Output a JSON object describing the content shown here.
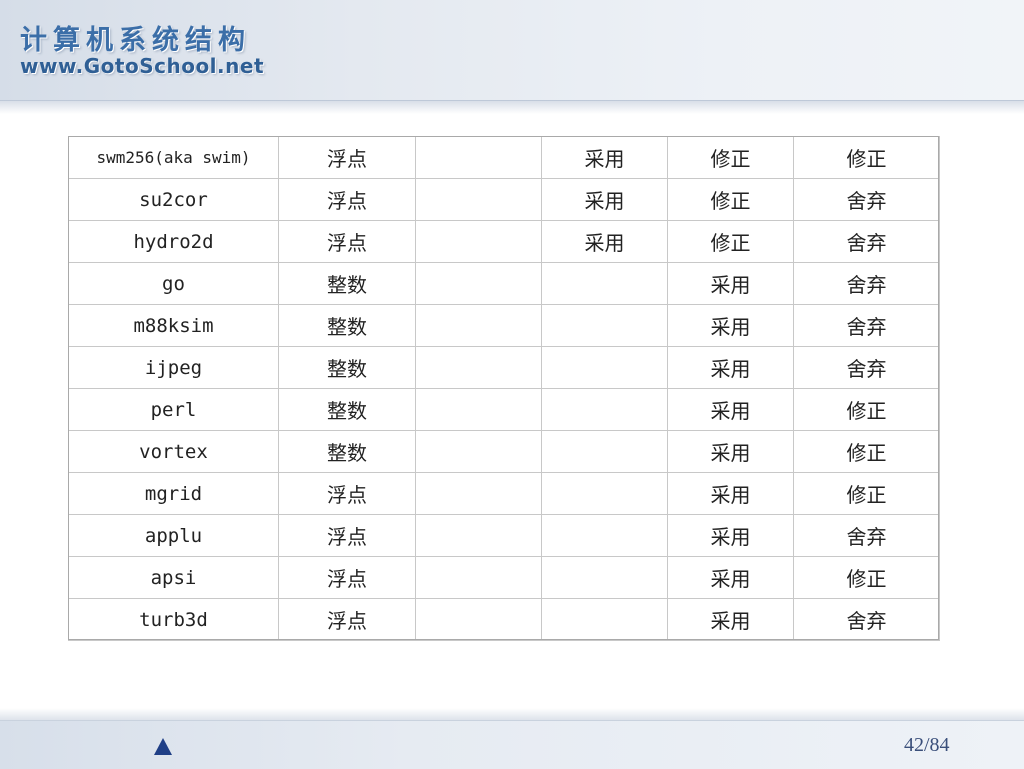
{
  "header": {
    "course_title": "计算机系统结构",
    "site_url": "www.GotoSchool.net"
  },
  "table": {
    "rows": [
      [
        "swm256(aka swim)",
        "浮点",
        "",
        "采用",
        "修正",
        "修正"
      ],
      [
        "su2cor",
        "浮点",
        "",
        "采用",
        "修正",
        "舍弃"
      ],
      [
        "hydro2d",
        "浮点",
        "",
        "采用",
        "修正",
        "舍弃"
      ],
      [
        "go",
        "整数",
        "",
        "",
        "采用",
        "舍弃"
      ],
      [
        "m88ksim",
        "整数",
        "",
        "",
        "采用",
        "舍弃"
      ],
      [
        "ijpeg",
        "整数",
        "",
        "",
        "采用",
        "舍弃"
      ],
      [
        "perl",
        "整数",
        "",
        "",
        "采用",
        "修正"
      ],
      [
        "vortex",
        "整数",
        "",
        "",
        "采用",
        "修正"
      ],
      [
        "mgrid",
        "浮点",
        "",
        "",
        "采用",
        "修正"
      ],
      [
        "applu",
        "浮点",
        "",
        "",
        "采用",
        "舍弃"
      ],
      [
        "apsi",
        "浮点",
        "",
        "",
        "采用",
        "修正"
      ],
      [
        "turb3d",
        "浮点",
        "",
        "",
        "采用",
        "舍弃"
      ]
    ]
  },
  "footer": {
    "prev_icon": "triangle-up-icon",
    "page_number": "42/84",
    "accent_color": "#1f3f86"
  }
}
